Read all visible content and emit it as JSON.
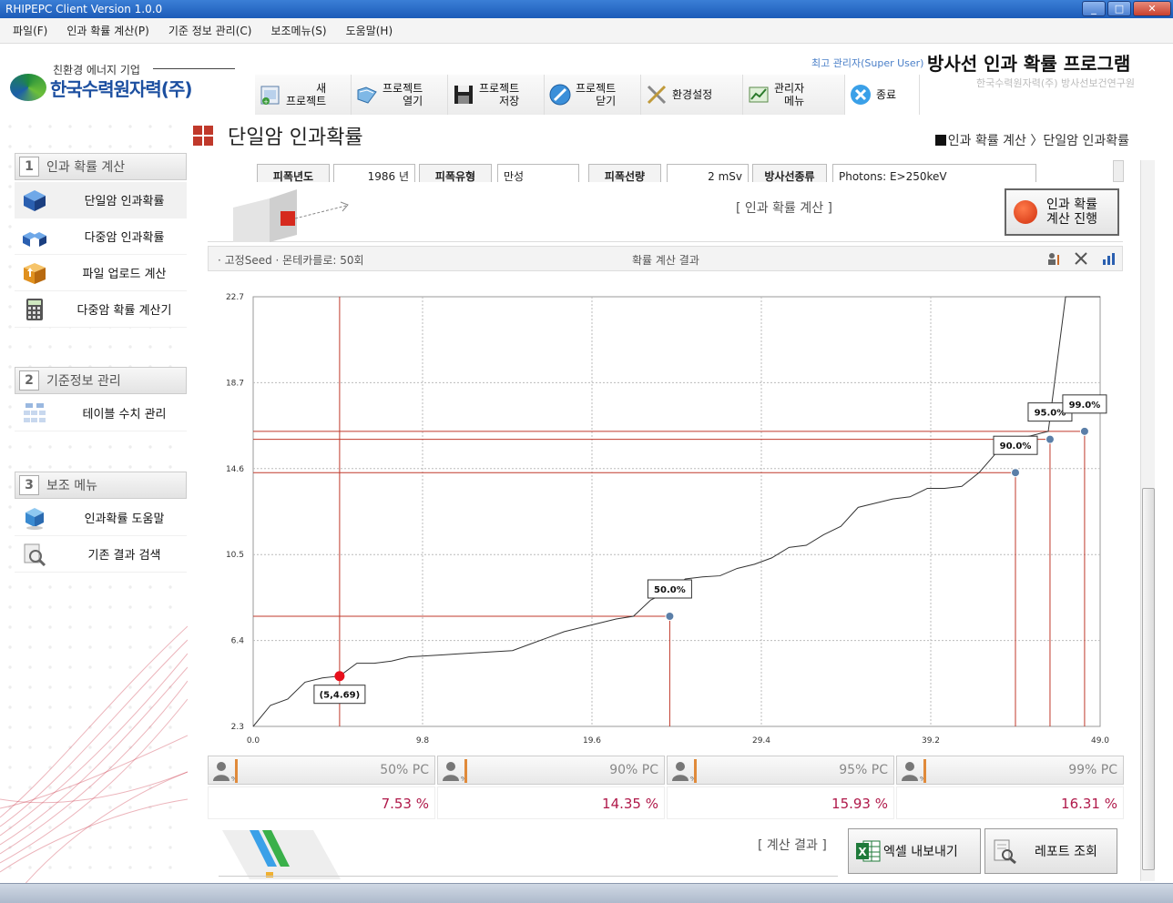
{
  "window": {
    "title": "RHIPEPC Client Version 1.0.0"
  },
  "menu": [
    "파일(F)",
    "인과 확률 계산(P)",
    "기준 정보 관리(C)",
    "보조메뉴(S)",
    "도움말(H)"
  ],
  "header": {
    "logo_sub": "친환경 에너지 기업",
    "logo_name": "한국수력원자력(주)",
    "user": "최고 관리자(Super User)",
    "program_title": "방사선 인과 확률 프로그램",
    "program_sub": "한국수력원자력(주) 방사선보건연구원"
  },
  "toolbar": [
    {
      "label": "새\n프로젝트",
      "icon": "new-project-icon"
    },
    {
      "label": "프로젝트\n열기",
      "icon": "open-project-icon"
    },
    {
      "label": "프로젝트\n저장",
      "icon": "save-icon"
    },
    {
      "label": "프로젝트\n닫기",
      "icon": "close-project-icon"
    },
    {
      "label": "환경설정",
      "icon": "settings-icon"
    },
    {
      "label": "관리자\n메뉴",
      "icon": "admin-icon"
    },
    {
      "label": "종료",
      "icon": "exit-icon"
    }
  ],
  "sidebar": {
    "sections": [
      {
        "num": "1",
        "title": "인과 확률 계산",
        "items": [
          {
            "label": "단일암 인과확률",
            "icon": "cube-icon",
            "active": true
          },
          {
            "label": "다중암 인과확률",
            "icon": "cubes-icon"
          },
          {
            "label": "파일 업로드 계산",
            "icon": "upload-box-icon"
          },
          {
            "label": "다중암 확률 계산기",
            "icon": "calculator-icon"
          }
        ]
      },
      {
        "num": "2",
        "title": "기준정보 관리",
        "items": [
          {
            "label": "테이블 수치 관리",
            "icon": "table-icon"
          }
        ]
      },
      {
        "num": "3",
        "title": "보조 메뉴",
        "items": [
          {
            "label": "인과확률 도움말",
            "icon": "help-icon"
          },
          {
            "label": "기존 결과 검색",
            "icon": "search-doc-icon"
          }
        ]
      }
    ]
  },
  "page": {
    "title": "단일암 인과확률",
    "breadcrumb_a": "인과 확률 계산",
    "breadcrumb_b": "단일암 인과확률"
  },
  "params": {
    "year_label": "피폭년도",
    "year_value": "1986 년",
    "type_label": "피폭유형",
    "type_value": "만성",
    "dose_label": "피폭선량",
    "dose_value": "2 mSv",
    "rad_label": "방사선종류",
    "rad_value": "Photons: E>250keV"
  },
  "calc": {
    "label": "[ 인과 확률 계산 ]",
    "run_label": "인과 확률\n계산 진행"
  },
  "results": {
    "seed": "· 고정Seed   · 몬테카를로: 50회",
    "title": "확률 계산 결과"
  },
  "chart_data": {
    "type": "line",
    "xlim": [
      0.0,
      49.0
    ],
    "ylim": [
      2.3,
      22.7
    ],
    "x_ticks": [
      "0.0",
      "9.8",
      "19.6",
      "29.4",
      "39.2",
      "49.0"
    ],
    "y_ticks": [
      "22.7",
      "18.7",
      "14.6",
      "10.5",
      "6.4",
      "2.3"
    ],
    "grid": true,
    "series": [
      {
        "x": [
          0,
          1,
          2,
          3,
          4,
          5,
          6,
          7,
          8,
          9,
          10,
          11,
          12,
          13,
          14,
          15,
          16,
          17,
          18,
          19,
          20,
          21,
          22,
          23,
          24,
          25,
          26,
          27,
          28,
          29,
          30,
          31,
          32,
          33,
          34,
          35,
          36,
          37,
          38,
          39,
          40,
          41,
          42,
          43,
          44,
          45,
          46,
          47,
          48,
          49
        ],
        "values": [
          2.3,
          3.3,
          3.6,
          4.4,
          4.6,
          4.69,
          5.3,
          5.3,
          5.4,
          5.6,
          5.65,
          5.7,
          5.75,
          5.8,
          5.85,
          5.9,
          6.2,
          6.5,
          6.8,
          7.0,
          7.2,
          7.4,
          7.53,
          8.3,
          8.7,
          9.3,
          9.4,
          9.45,
          9.8,
          10.0,
          10.3,
          10.8,
          10.9,
          11.4,
          11.8,
          12.7,
          12.9,
          13.1,
          13.2,
          13.6,
          13.6,
          13.7,
          14.35,
          15.3,
          15.93,
          16.1,
          16.31,
          22.7,
          22.7,
          22.7
        ]
      }
    ],
    "highlight_point": {
      "x": 5,
      "y": 4.69,
      "label": "(5,4.69)"
    },
    "percentiles": [
      {
        "label": "50.0%",
        "x": 24.1,
        "y": 7.53
      },
      {
        "label": "90.0%",
        "x": 44.1,
        "y": 14.35
      },
      {
        "label": "95.0%",
        "x": 46.1,
        "y": 15.93
      },
      {
        "label": "99.0%",
        "x": 48.1,
        "y": 16.31
      }
    ]
  },
  "pc": [
    {
      "label": "50% PC",
      "value": "7.53 %"
    },
    {
      "label": "90% PC",
      "value": "14.35 %"
    },
    {
      "label": "95% PC",
      "value": "15.93 %"
    },
    {
      "label": "99% PC",
      "value": "16.31 %"
    }
  ],
  "bottom": {
    "label": "[ 계산 결과 ]",
    "excel": "엑셀 내보내기",
    "report": "레포트 조회"
  },
  "colors": {
    "accent_red": "#c0392b",
    "pc_value": "#b0194a",
    "line": "#333333",
    "marker": "#5b7fa8"
  }
}
